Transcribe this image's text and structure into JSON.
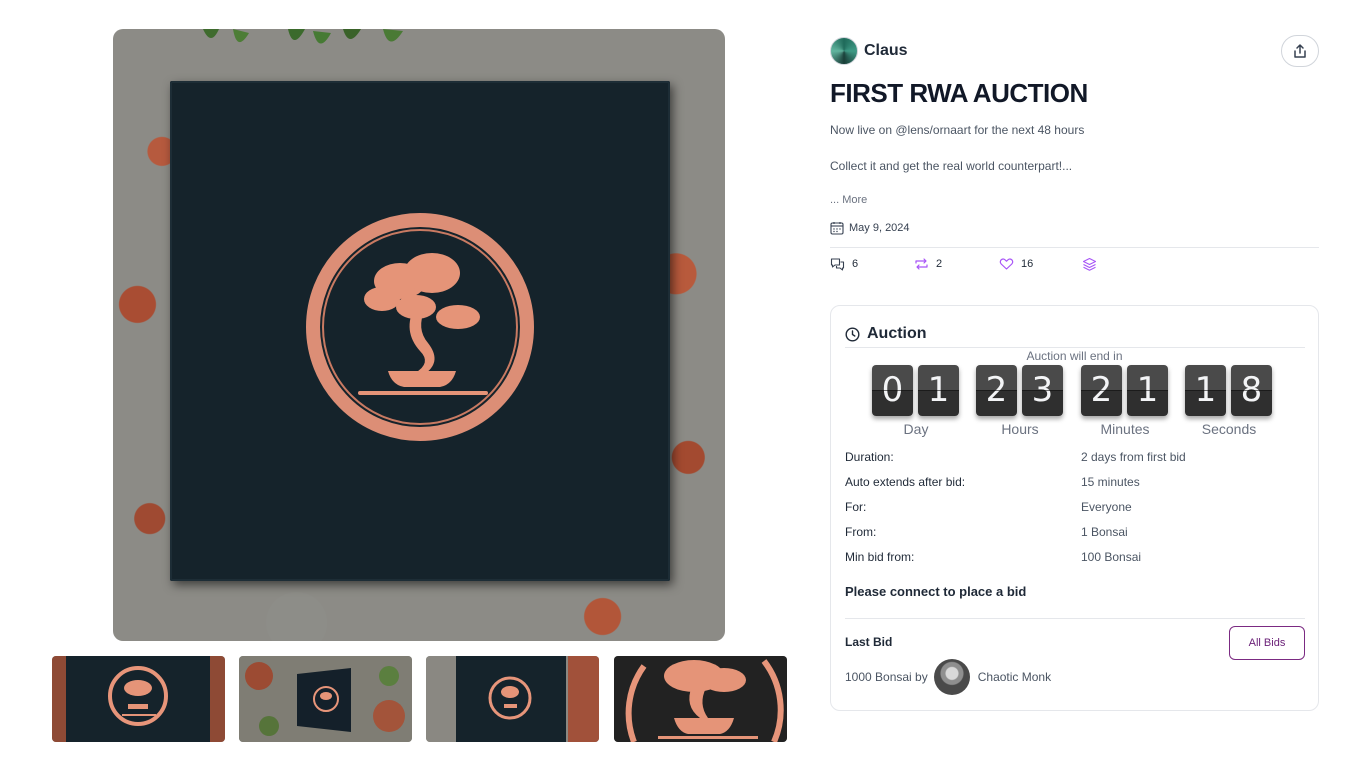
{
  "gallery": {
    "main_alt": "artwork-main",
    "thumbnails": [
      {
        "name": "thumb-1"
      },
      {
        "name": "thumb-2"
      },
      {
        "name": "thumb-3"
      },
      {
        "name": "thumb-4"
      }
    ]
  },
  "post": {
    "author": "Claus",
    "title": "FIRST RWA AUCTION",
    "description_line1": "Now live on @lens/ornaart for the next 48 hours",
    "description_line2": "Collect it and get the real world counterpart!...",
    "more_label": "... More",
    "date": "May 9, 2024",
    "stats": {
      "comments": "6",
      "mirrors": "2",
      "likes": "16"
    },
    "icons": {
      "share": "share-icon",
      "calendar": "calendar-icon",
      "comments": "comment-icon",
      "mirrors": "repost-icon",
      "likes": "heart-icon",
      "collect": "layers-icon"
    }
  },
  "auction": {
    "title": "Auction",
    "ends_label": "Auction will end in",
    "countdown": {
      "day": [
        "0",
        "1"
      ],
      "hours": [
        "2",
        "3"
      ],
      "minutes": [
        "2",
        "1"
      ],
      "seconds": [
        "1",
        "8"
      ],
      "labels": {
        "day": "Day",
        "hours": "Hours",
        "minutes": "Minutes",
        "seconds": "Seconds"
      }
    },
    "details": [
      {
        "label": "Duration:",
        "value": "2 days from first bid"
      },
      {
        "label": "Auto extends after bid:",
        "value": "15 minutes"
      },
      {
        "label": "For:",
        "value": "Everyone"
      },
      {
        "label": "From:",
        "value": "1 Bonsai"
      },
      {
        "label": "Min bid from:",
        "value": "100 Bonsai"
      }
    ],
    "connect_prompt": "Please connect to place a bid",
    "last_bid_label": "Last Bid",
    "all_bids_label": "All Bids",
    "last_bid_amount": "1000 Bonsai by",
    "last_bidder": "Chaotic Monk"
  },
  "colors": {
    "accent": "#7b2a82",
    "stat_icon": "#a855f7",
    "copper": "#e7957a",
    "canvas": "#15232b"
  }
}
